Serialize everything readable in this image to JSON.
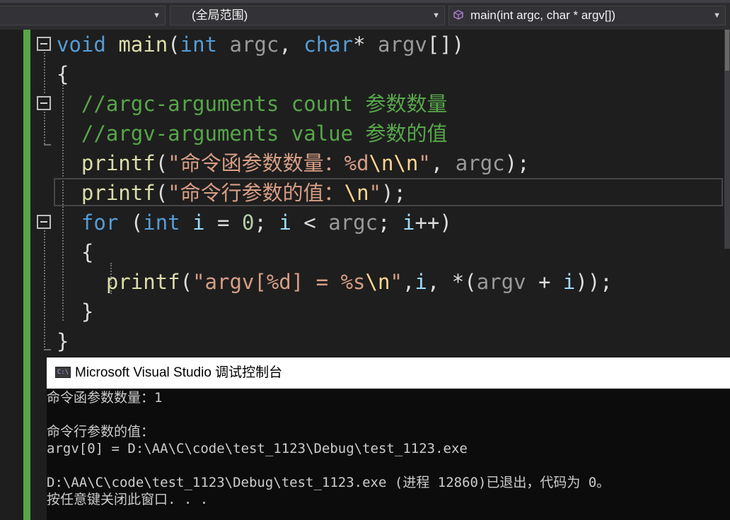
{
  "navbar": {
    "scope_combo": "(全局范围)",
    "member_combo": "main(int argc, char * argv[])"
  },
  "code": {
    "l1": {
      "kw_void": "void",
      "fn_main": "main",
      "p1": "(",
      "kw_int": "int",
      "argc": "argc",
      "comma": ", ",
      "kw_char": "char",
      "star": "*",
      "argv": "argv",
      "p2": "[])"
    },
    "l2": "{",
    "l3": "//argc-arguments count 参数数量",
    "l4": "//argv-arguments value 参数的值",
    "l5": {
      "fn": "printf",
      "p1": "(",
      "s1": "\"命令函参数数量：%d",
      "esc": "\\n\\n",
      "s2": "\"",
      "rest": ", ",
      "argc": "argc",
      "end": ");"
    },
    "l6": {
      "fn": "printf",
      "p1": "(",
      "s1": "\"命令行参数的值：",
      "esc": "\\n",
      "s2": "\"",
      "end": ");"
    },
    "l7": {
      "kw_for": "for",
      "p1": " (",
      "kw_int": "int",
      "i1": "i",
      "eq": " = ",
      "zero": "0",
      "semi1": "; ",
      "i2": "i",
      "lt": " < ",
      "argc": "argc",
      "semi2": "; ",
      "i3": "i",
      "end": "++)"
    },
    "l8": "{",
    "l9": {
      "fn": "printf",
      "p1": "(",
      "s1": "\"argv[%d] = %s",
      "esc": "\\n",
      "s2": "\"",
      "c1": ",",
      "i": "i",
      "c2": ", *(",
      "argv": "argv",
      "plus": " + ",
      "i2": "i",
      "end": "));"
    },
    "l10": "}",
    "l11": "}"
  },
  "console": {
    "title": "Microsoft Visual Studio 调试控制台",
    "icon_text": "C:\\",
    "lines": [
      "命令函参数数量：1",
      "",
      "命令行参数的值：",
      "argv[0] = D:\\AA\\C\\code\\test_1123\\Debug\\test_1123.exe",
      "",
      "D:\\AA\\C\\code\\test_1123\\Debug\\test_1123.exe (进程 12860)已退出，代码为 0。",
      "按任意键关闭此窗口. . ."
    ]
  },
  "colors": {
    "background": "#1e1e1e",
    "keyword": "#569cd6",
    "function": "#dcdcaa",
    "comment": "#57a64a",
    "string": "#d69d85",
    "escape": "#ffd68f",
    "change_bar": "#57a64a"
  },
  "icons": [
    "dropdown-arrow-icon",
    "member-cube-icon",
    "fold-collapse-icon",
    "console-app-icon"
  ]
}
